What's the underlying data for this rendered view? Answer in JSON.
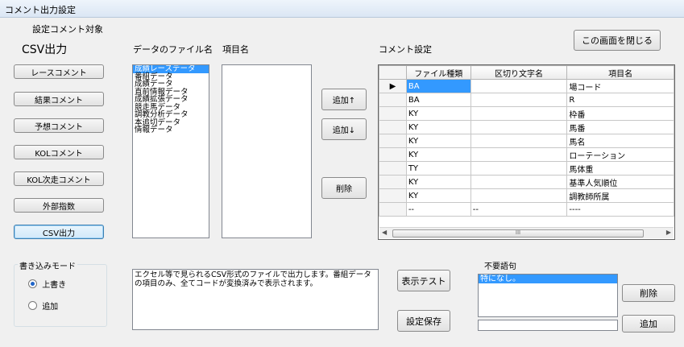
{
  "window": {
    "title": "コメント出力設定"
  },
  "labels": {
    "target_heading": "設定コメント対象",
    "csv_heading": "CSV出力",
    "data_files": "データのファイル名",
    "item_names": "項目名",
    "comment_settings": "コメント設定",
    "write_mode": "書き込みモード",
    "unneeded_words": "不要語句"
  },
  "left_buttons": [
    "レースコメント",
    "結果コメント",
    "予想コメント",
    "KOLコメント",
    "KOL次走コメント",
    "外部指数",
    "CSV出力"
  ],
  "buttons": {
    "close": "この画面を閉じる",
    "add_up": "追加↑",
    "add_down": "追加↓",
    "delete": "削除",
    "display_test": "表示テスト",
    "save_settings": "設定保存",
    "word_delete": "削除",
    "word_add": "追加"
  },
  "data_files": [
    "成績レースデータ",
    "番組データ",
    "成績データ",
    "直前情報データ",
    "成績拡張データ",
    "競走馬データ",
    "調教分析データ",
    "本追切データ",
    "情報データ"
  ],
  "grid": {
    "columns": [
      "ファイル種類",
      "区切り文字名",
      "項目名"
    ],
    "rows": [
      [
        "BA",
        "",
        "場コード"
      ],
      [
        "BA",
        "",
        "R"
      ],
      [
        "KY",
        "",
        "枠番"
      ],
      [
        "KY",
        "",
        "馬番"
      ],
      [
        "KY",
        "",
        "馬名"
      ],
      [
        "KY",
        "",
        "ローテーション"
      ],
      [
        "TY",
        "",
        "馬体重"
      ],
      [
        "KY",
        "",
        "基準人気順位"
      ],
      [
        "KY",
        "",
        "調教師所属"
      ],
      [
        "--",
        "--",
        "----"
      ]
    ],
    "scroll_grip": "III"
  },
  "write_mode": {
    "options": [
      "上書き",
      "追加"
    ],
    "selected": 0
  },
  "description": "エクセル等で見られるCSV形式のファイルで出力します。番組データの項目のみ、全てコードが変換済みで表示されます。",
  "unneeded_words_list": [
    "特になし。"
  ],
  "colors": {
    "selection": "#3399ff",
    "background": "#f0f0f0"
  }
}
